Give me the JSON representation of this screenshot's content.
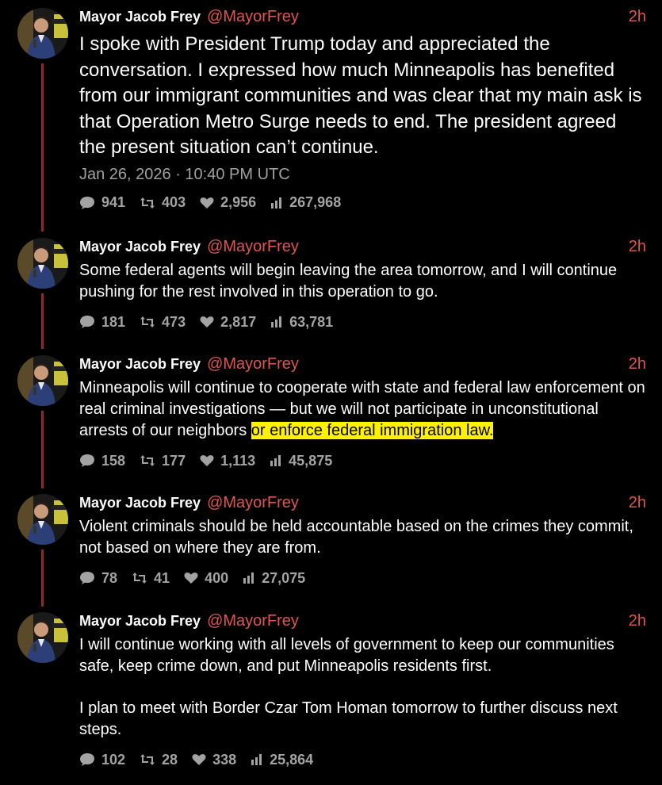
{
  "author": {
    "name": "Mayor Jacob Frey",
    "handle": "@MayorFrey"
  },
  "tweets": [
    {
      "time": "2h",
      "paragraphs": [
        "I spoke with President Trump today and appreciated the conversation. I expressed how much Minneapolis has benefited from our immigrant communities and was clear that my main ask is that Operation Metro Surge needs to end. The president agreed the present situation can’t continue."
      ],
      "date": "Jan 26, 2026 · 10:40 PM UTC",
      "replies": "941",
      "retweets": "403",
      "likes": "2,956",
      "views": "267,968"
    },
    {
      "time": "2h",
      "paragraphs": [
        "Some federal agents will begin leaving the area tomorrow, and I will continue pushing for the rest involved in this operation to go."
      ],
      "replies": "181",
      "retweets": "473",
      "likes": "2,817",
      "views": "63,781"
    },
    {
      "time": "2h",
      "text_plain": "Minneapolis will continue to cooperate with state and federal law enforcement on real criminal investigations — but we will not participate in unconstitutional arrests of our neighbors ",
      "text_highlight": "or enforce federal immigration law.",
      "replies": "158",
      "retweets": "177",
      "likes": "1,113",
      "views": "45,875"
    },
    {
      "time": "2h",
      "paragraphs": [
        "Violent criminals should be held accountable based on the crimes they commit, not based on where they are from."
      ],
      "replies": "78",
      "retweets": "41",
      "likes": "400",
      "views": "27,075"
    },
    {
      "time": "2h",
      "paragraphs": [
        "I will continue working with all levels of government to keep our communities safe, keep crime down, and put Minneapolis residents first.",
        "I plan to meet with Border Czar Tom Homan tomorrow to further discuss next steps."
      ],
      "replies": "102",
      "retweets": "28",
      "likes": "338",
      "views": "25,864"
    }
  ],
  "icons": {
    "reply": "comment-bubble-icon",
    "retweet": "retweet-arrows-icon",
    "like": "heart-icon",
    "views": "bar-chart-icon"
  },
  "colors": {
    "accent": "#e0554f",
    "thread_line": "#8b2e2b",
    "highlight": "#fff200",
    "muted": "#a3a3a3"
  }
}
